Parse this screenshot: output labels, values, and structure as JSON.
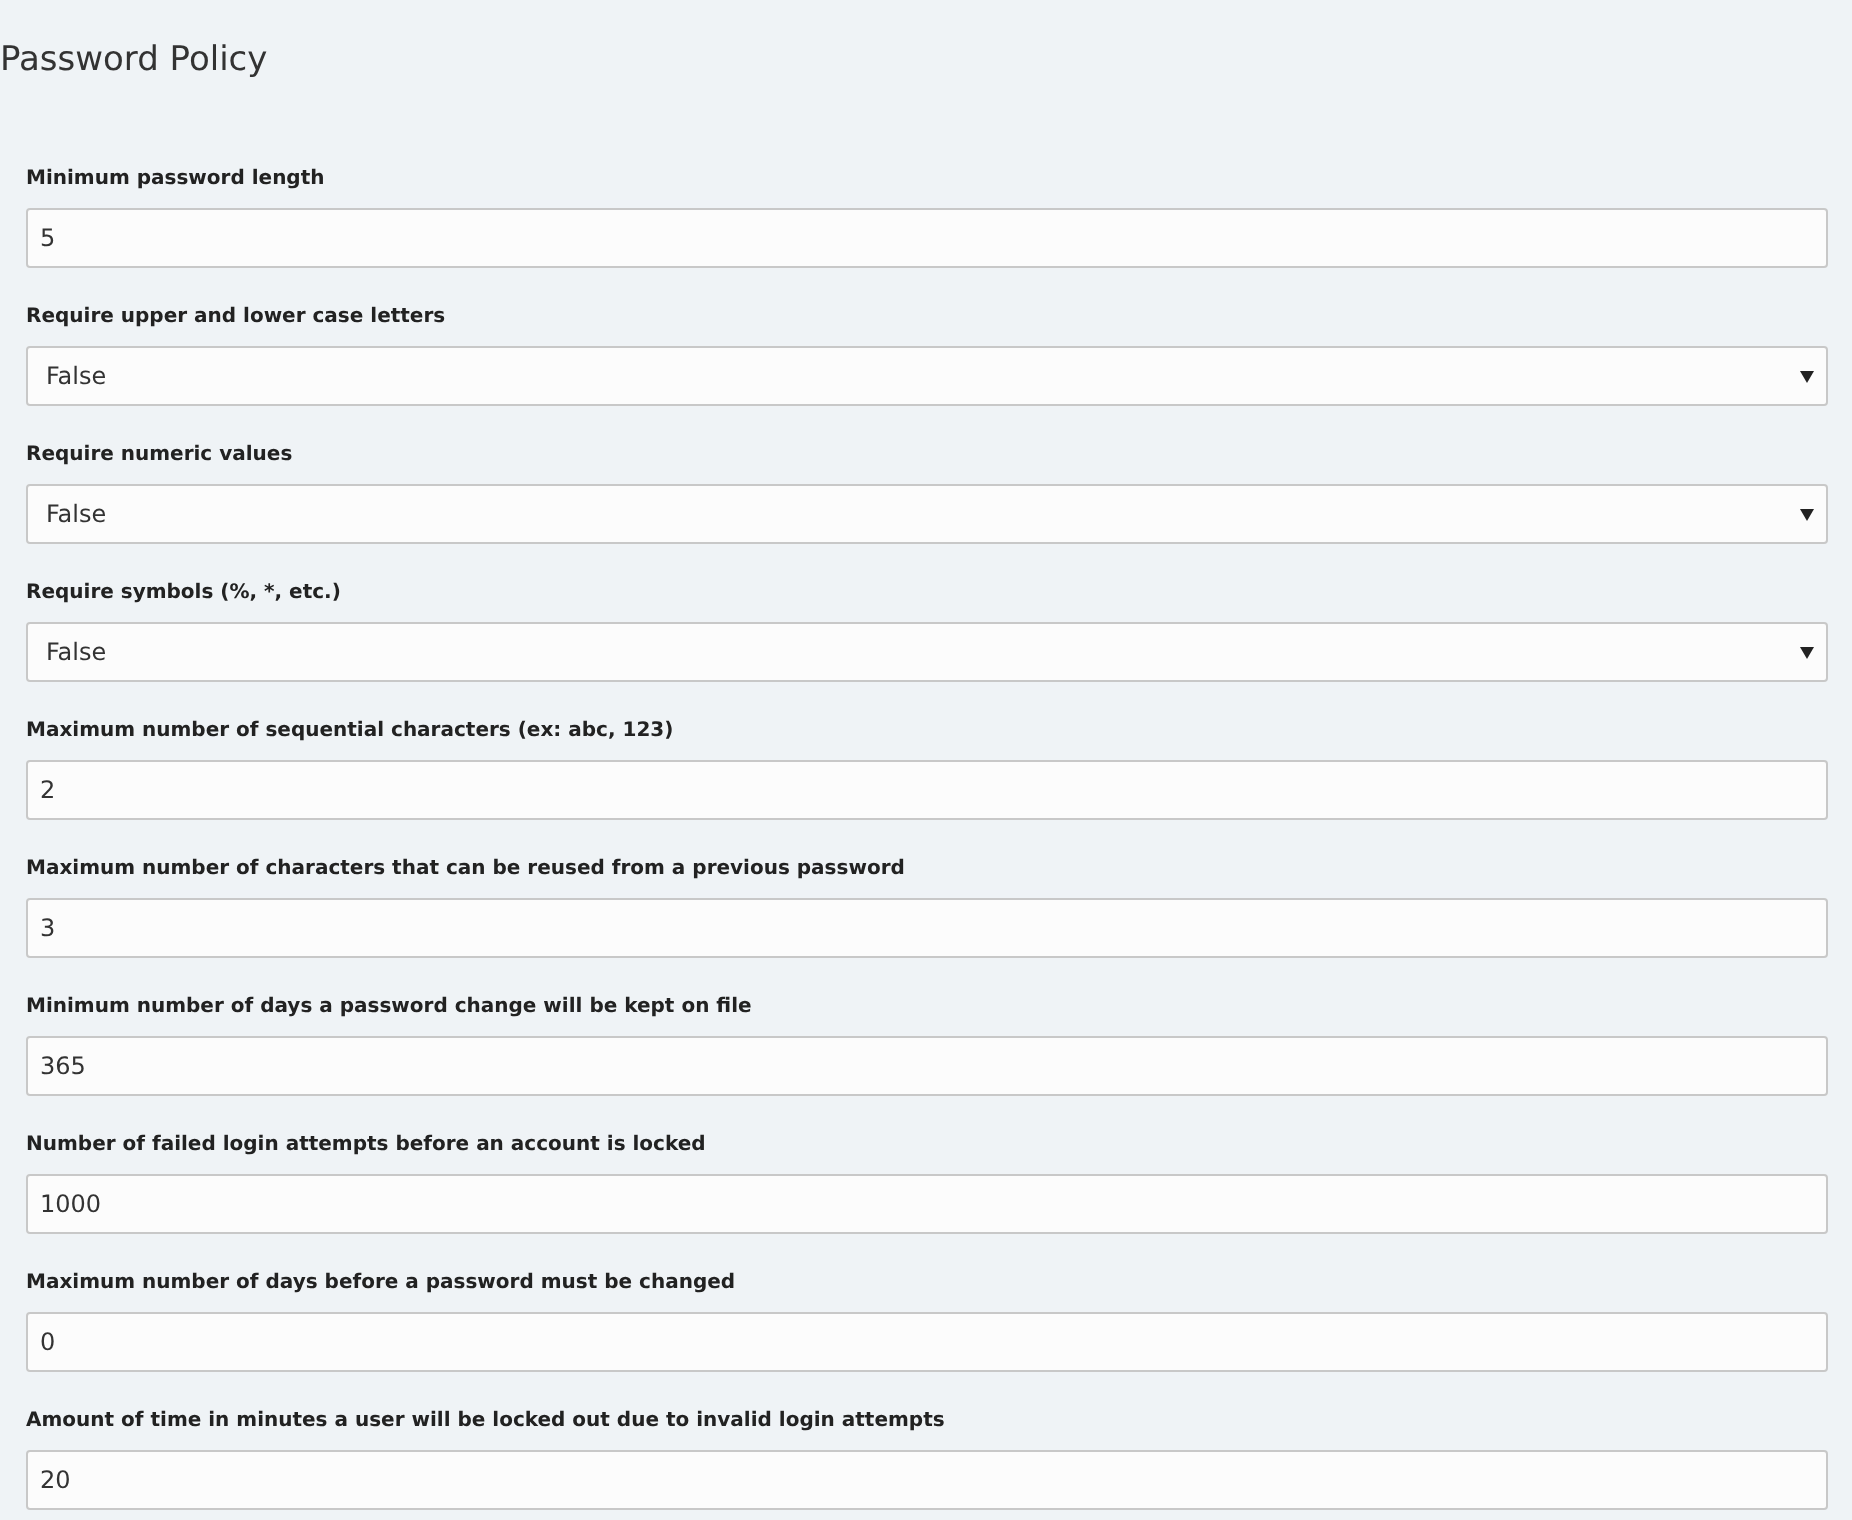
{
  "title": "Password Policy",
  "fields": [
    {
      "kind": "text",
      "label": "Minimum password length",
      "value": "5"
    },
    {
      "kind": "select",
      "label": "Require upper and lower case letters",
      "value": "False"
    },
    {
      "kind": "select",
      "label": "Require numeric values",
      "value": "False"
    },
    {
      "kind": "select",
      "label": "Require symbols (%, *, etc.)",
      "value": "False"
    },
    {
      "kind": "text",
      "label": "Maximum number of sequential characters (ex: abc, 123)",
      "value": "2"
    },
    {
      "kind": "text",
      "label": "Maximum number of characters that can be reused from a previous password",
      "value": "3"
    },
    {
      "kind": "text",
      "label": "Minimum number of days a password change will be kept on file",
      "value": "365"
    },
    {
      "kind": "text",
      "label": "Number of failed login attempts before an account is locked",
      "value": "1000"
    },
    {
      "kind": "text",
      "label": "Maximum number of days before a password must be changed",
      "value": "0"
    },
    {
      "kind": "text",
      "label": "Amount of time in minutes a user will be locked out due to invalid login attempts",
      "value": "20"
    }
  ]
}
